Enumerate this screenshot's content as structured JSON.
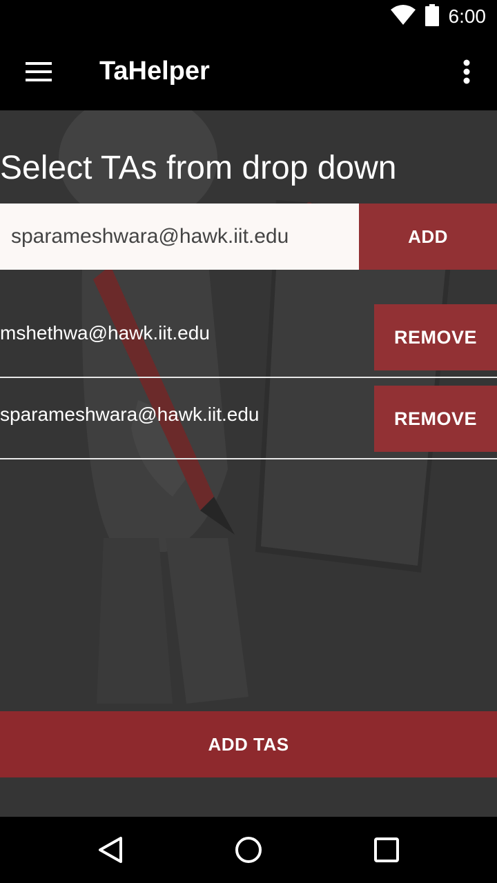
{
  "status_bar": {
    "time": "6:00",
    "icons": [
      "wifi-icon",
      "battery-icon"
    ]
  },
  "app_bar": {
    "title": "TaHelper",
    "menu_icon": "hamburger-menu-icon",
    "overflow_icon": "more-vert-icon"
  },
  "main": {
    "heading": "Select TAs from drop down",
    "dropdown": {
      "selected_value": "sparameshwara@hawk.iit.edu"
    },
    "add_label": "ADD",
    "ta_list": [
      {
        "email": "mshethwa@hawk.iit.edu",
        "remove_label": "REMOVE"
      },
      {
        "email": "sparameshwara@hawk.iit.edu",
        "remove_label": "REMOVE"
      }
    ],
    "add_tas_label": "ADD TAS"
  },
  "nav_bar": {
    "icons": [
      "back-icon",
      "home-icon",
      "recents-icon"
    ]
  },
  "colors": {
    "accent": "#923134",
    "background": "#353535",
    "bars": "#000000"
  }
}
